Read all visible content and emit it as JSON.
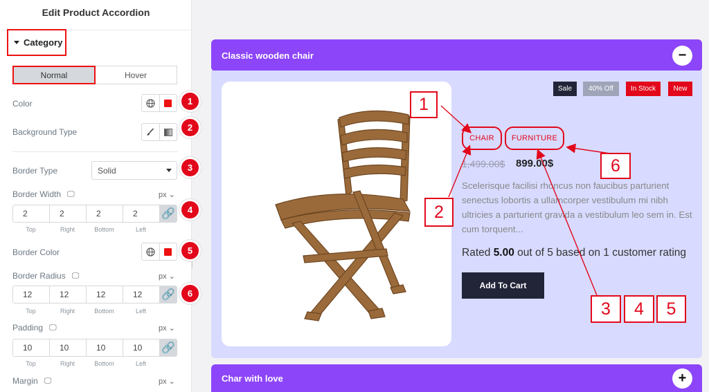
{
  "panel": {
    "title": "Edit Product Accordion",
    "section_label": "Category",
    "tabs": [
      {
        "label": "Normal",
        "active": true
      },
      {
        "label": "Hover",
        "active": false
      }
    ],
    "controls": {
      "color_label": "Color",
      "background_type_label": "Background Type",
      "border_type_label": "Border Type",
      "border_type_value": "Solid",
      "border_width_label": "Border Width",
      "border_width_unit": "px",
      "border_width_values": [
        "2",
        "2",
        "2",
        "2"
      ],
      "border_color_label": "Border Color",
      "border_radius_label": "Border Radius",
      "border_radius_unit": "px",
      "border_radius_values": [
        "12",
        "12",
        "12",
        "12"
      ],
      "padding_label": "Padding",
      "padding_unit": "px",
      "padding_values": [
        "10",
        "10",
        "10",
        "10"
      ],
      "margin_label": "Margin",
      "margin_unit": "px",
      "sides": [
        "Top",
        "Right",
        "Bottom",
        "Left"
      ]
    },
    "badges": [
      "1",
      "2",
      "3",
      "4",
      "5",
      "6"
    ]
  },
  "preview": {
    "item1_title": "Classic wooden chair",
    "item1_toggle": "−",
    "item2_title": "Char with love",
    "item2_toggle": "+",
    "labels": {
      "sale": "Sale",
      "discount": "40% Off",
      "stock": "In Stock",
      "new": "New"
    },
    "categories": [
      "CHAIR",
      "FURNITURE"
    ],
    "old_price": "1,499.00$",
    "new_price": "899.00$",
    "description": "Scelerisque facilisi rhoncus non faucibus parturient senectus lobortis a ullamcorper vestibulum mi nibh ultricies a parturient gravida a vestibulum leo sem in. Est cum torquent...",
    "rating": {
      "prefix": "Rated",
      "value": "5.00",
      "suffix": "out of 5 based on 1 customer rating"
    },
    "cart_button": "Add To Cart"
  },
  "callouts": [
    "1",
    "2",
    "3",
    "4",
    "5",
    "6"
  ],
  "colors": {
    "accent": "#e3071b",
    "accordion_header": "#8c45f9",
    "accordion_body": "#d8dbff",
    "sale_badge": "#222538",
    "discount_badge": "#a0a4b8",
    "stock_badge": "#e3071b",
    "new_badge": "#e3071b"
  }
}
